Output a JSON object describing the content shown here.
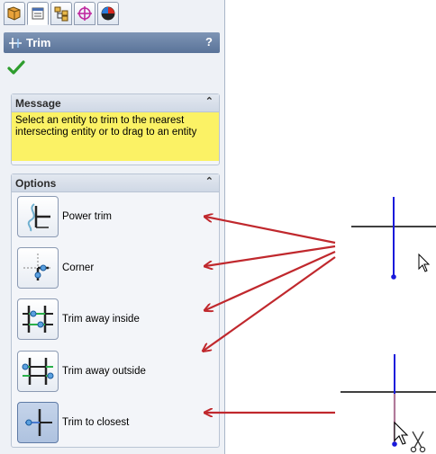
{
  "panel": {
    "tabs": [
      {
        "icon": "feature-manager-icon"
      },
      {
        "icon": "property-manager-icon"
      },
      {
        "icon": "configuration-manager-icon"
      },
      {
        "icon": "dimxpert-icon"
      },
      {
        "icon": "display-manager-icon"
      }
    ],
    "title": "Trim",
    "help_label": "?",
    "ok_icon": "green-checkmark-icon"
  },
  "message_group": {
    "header": "Message",
    "text": "Select an entity to trim to the nearest intersecting entity or to drag to an entity"
  },
  "options_group": {
    "header": "Options",
    "options": [
      {
        "label": "Power trim",
        "icon": "power-trim-icon",
        "selected": false
      },
      {
        "label": "Corner",
        "icon": "corner-icon",
        "selected": false
      },
      {
        "label": "Trim away inside",
        "icon": "trim-away-inside-icon",
        "selected": false
      },
      {
        "label": "Trim away outside",
        "icon": "trim-away-outside-icon",
        "selected": false
      },
      {
        "label": "Trim to closest",
        "icon": "trim-to-closest-icon",
        "selected": true
      }
    ]
  },
  "colors": {
    "title_bar": "#5a7399",
    "message_bg": "#fbf265",
    "arrow": "#c0282d",
    "sketch_line_blue": "#1a1adb",
    "check_green": "#2e9d2e"
  }
}
